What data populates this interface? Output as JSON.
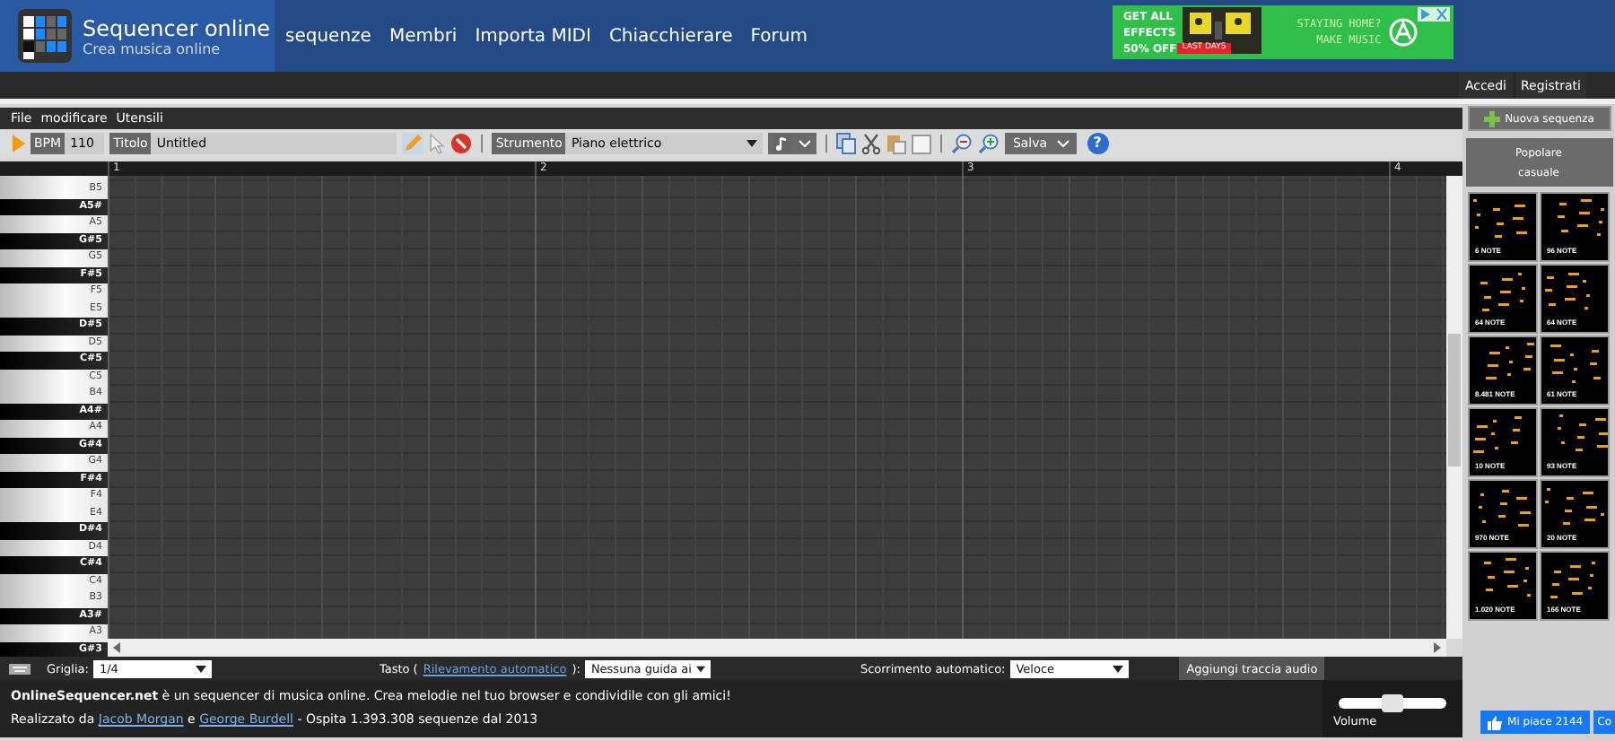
{
  "site": {
    "title": "Sequencer online",
    "subtitle": "Crea musica online"
  },
  "nav": [
    "sequenze",
    "Membri",
    "Importa MIDI",
    "Chiacchierare",
    "Forum"
  ],
  "ad": {
    "headline": [
      "GET ALL",
      "EFFECTS",
      "50% OFF"
    ],
    "badge": "LAST DAYS",
    "slogan": [
      "STAYING HOME?",
      "MAKE MUSIC"
    ]
  },
  "account": [
    "Accedi",
    "Registrati"
  ],
  "menu": [
    "File",
    "modificare",
    "Utensili"
  ],
  "toolbar": {
    "bpm_label": "BPM",
    "bpm": "110",
    "title_label": "Titolo",
    "title": "Untitled",
    "instrument_label": "Strumento",
    "instrument": "Piano elettrico",
    "save": "Salva",
    "help": "?"
  },
  "bars": [
    "1",
    "2",
    "3",
    "4"
  ],
  "keys": [
    {
      "label": "B5",
      "kind": "white"
    },
    {
      "label": "A5#",
      "kind": "black"
    },
    {
      "label": "A5",
      "kind": "white"
    },
    {
      "label": "G#5",
      "kind": "black"
    },
    {
      "label": "G5",
      "kind": "white"
    },
    {
      "label": "F#5",
      "kind": "black"
    },
    {
      "label": "F5",
      "kind": "white"
    },
    {
      "label": "E5",
      "kind": "white"
    },
    {
      "label": "D#5",
      "kind": "black"
    },
    {
      "label": "D5",
      "kind": "white"
    },
    {
      "label": "C#5",
      "kind": "black"
    },
    {
      "label": "C5",
      "kind": "white"
    },
    {
      "label": "B4",
      "kind": "white"
    },
    {
      "label": "A4#",
      "kind": "black"
    },
    {
      "label": "A4",
      "kind": "white"
    },
    {
      "label": "G#4",
      "kind": "black"
    },
    {
      "label": "G4",
      "kind": "white"
    },
    {
      "label": "F#4",
      "kind": "black"
    },
    {
      "label": "F4",
      "kind": "white"
    },
    {
      "label": "E4",
      "kind": "white"
    },
    {
      "label": "D#4",
      "kind": "black"
    },
    {
      "label": "D4",
      "kind": "white"
    },
    {
      "label": "C#4",
      "kind": "black"
    },
    {
      "label": "C4",
      "kind": "white"
    },
    {
      "label": "B3",
      "kind": "white"
    },
    {
      "label": "A3#",
      "kind": "black"
    },
    {
      "label": "A3",
      "kind": "white"
    },
    {
      "label": "G#3",
      "kind": "black"
    }
  ],
  "controls": {
    "grid_label": "Griglia:",
    "grid": "1/4",
    "key_prefix": "Tasto (",
    "key_link": "Rilevamento automatico",
    "key_suffix": "):",
    "key": "Nessuna guida ai",
    "scroll_label": "Scorrimento automatico:",
    "scroll": "Veloce",
    "add_audio": "Aggiungi traccia audio"
  },
  "footer": {
    "intro": "**OnlineSequencer.net** è un sequencer di musica online. Crea melodie nel tuo browser e condividile con gli amici!",
    "credits": [
      {
        "text": "Realizzato da",
        "kind": "text"
      },
      {
        "text": "Jacob Morgan",
        "kind": "link"
      },
      {
        "text": "e",
        "kind": "text"
      },
      {
        "text": "George Burdell",
        "kind": "link"
      },
      {
        "text": "- Ospita 1.393.308 sequenze dal 2013",
        "kind": "text"
      }
    ],
    "volume_label": "Volume",
    "volume": {
      "level": 0.5
    }
  },
  "sidebar": {
    "new": "Nuova sequenza",
    "tabs": [
      "Popolare",
      "casuale"
    ],
    "thumbnails": [
      "6 NOTE",
      "96 NOTE",
      "64 NOTE",
      "64 NOTE",
      "8.481 NOTE",
      "61 NOTE",
      "10 NOTE",
      "93 NOTE",
      "970 NOTE",
      "20 NOTE",
      "1.020 NOTE",
      "166 NOTE"
    ],
    "like": "Mi piace 2144",
    "share": "Co"
  }
}
